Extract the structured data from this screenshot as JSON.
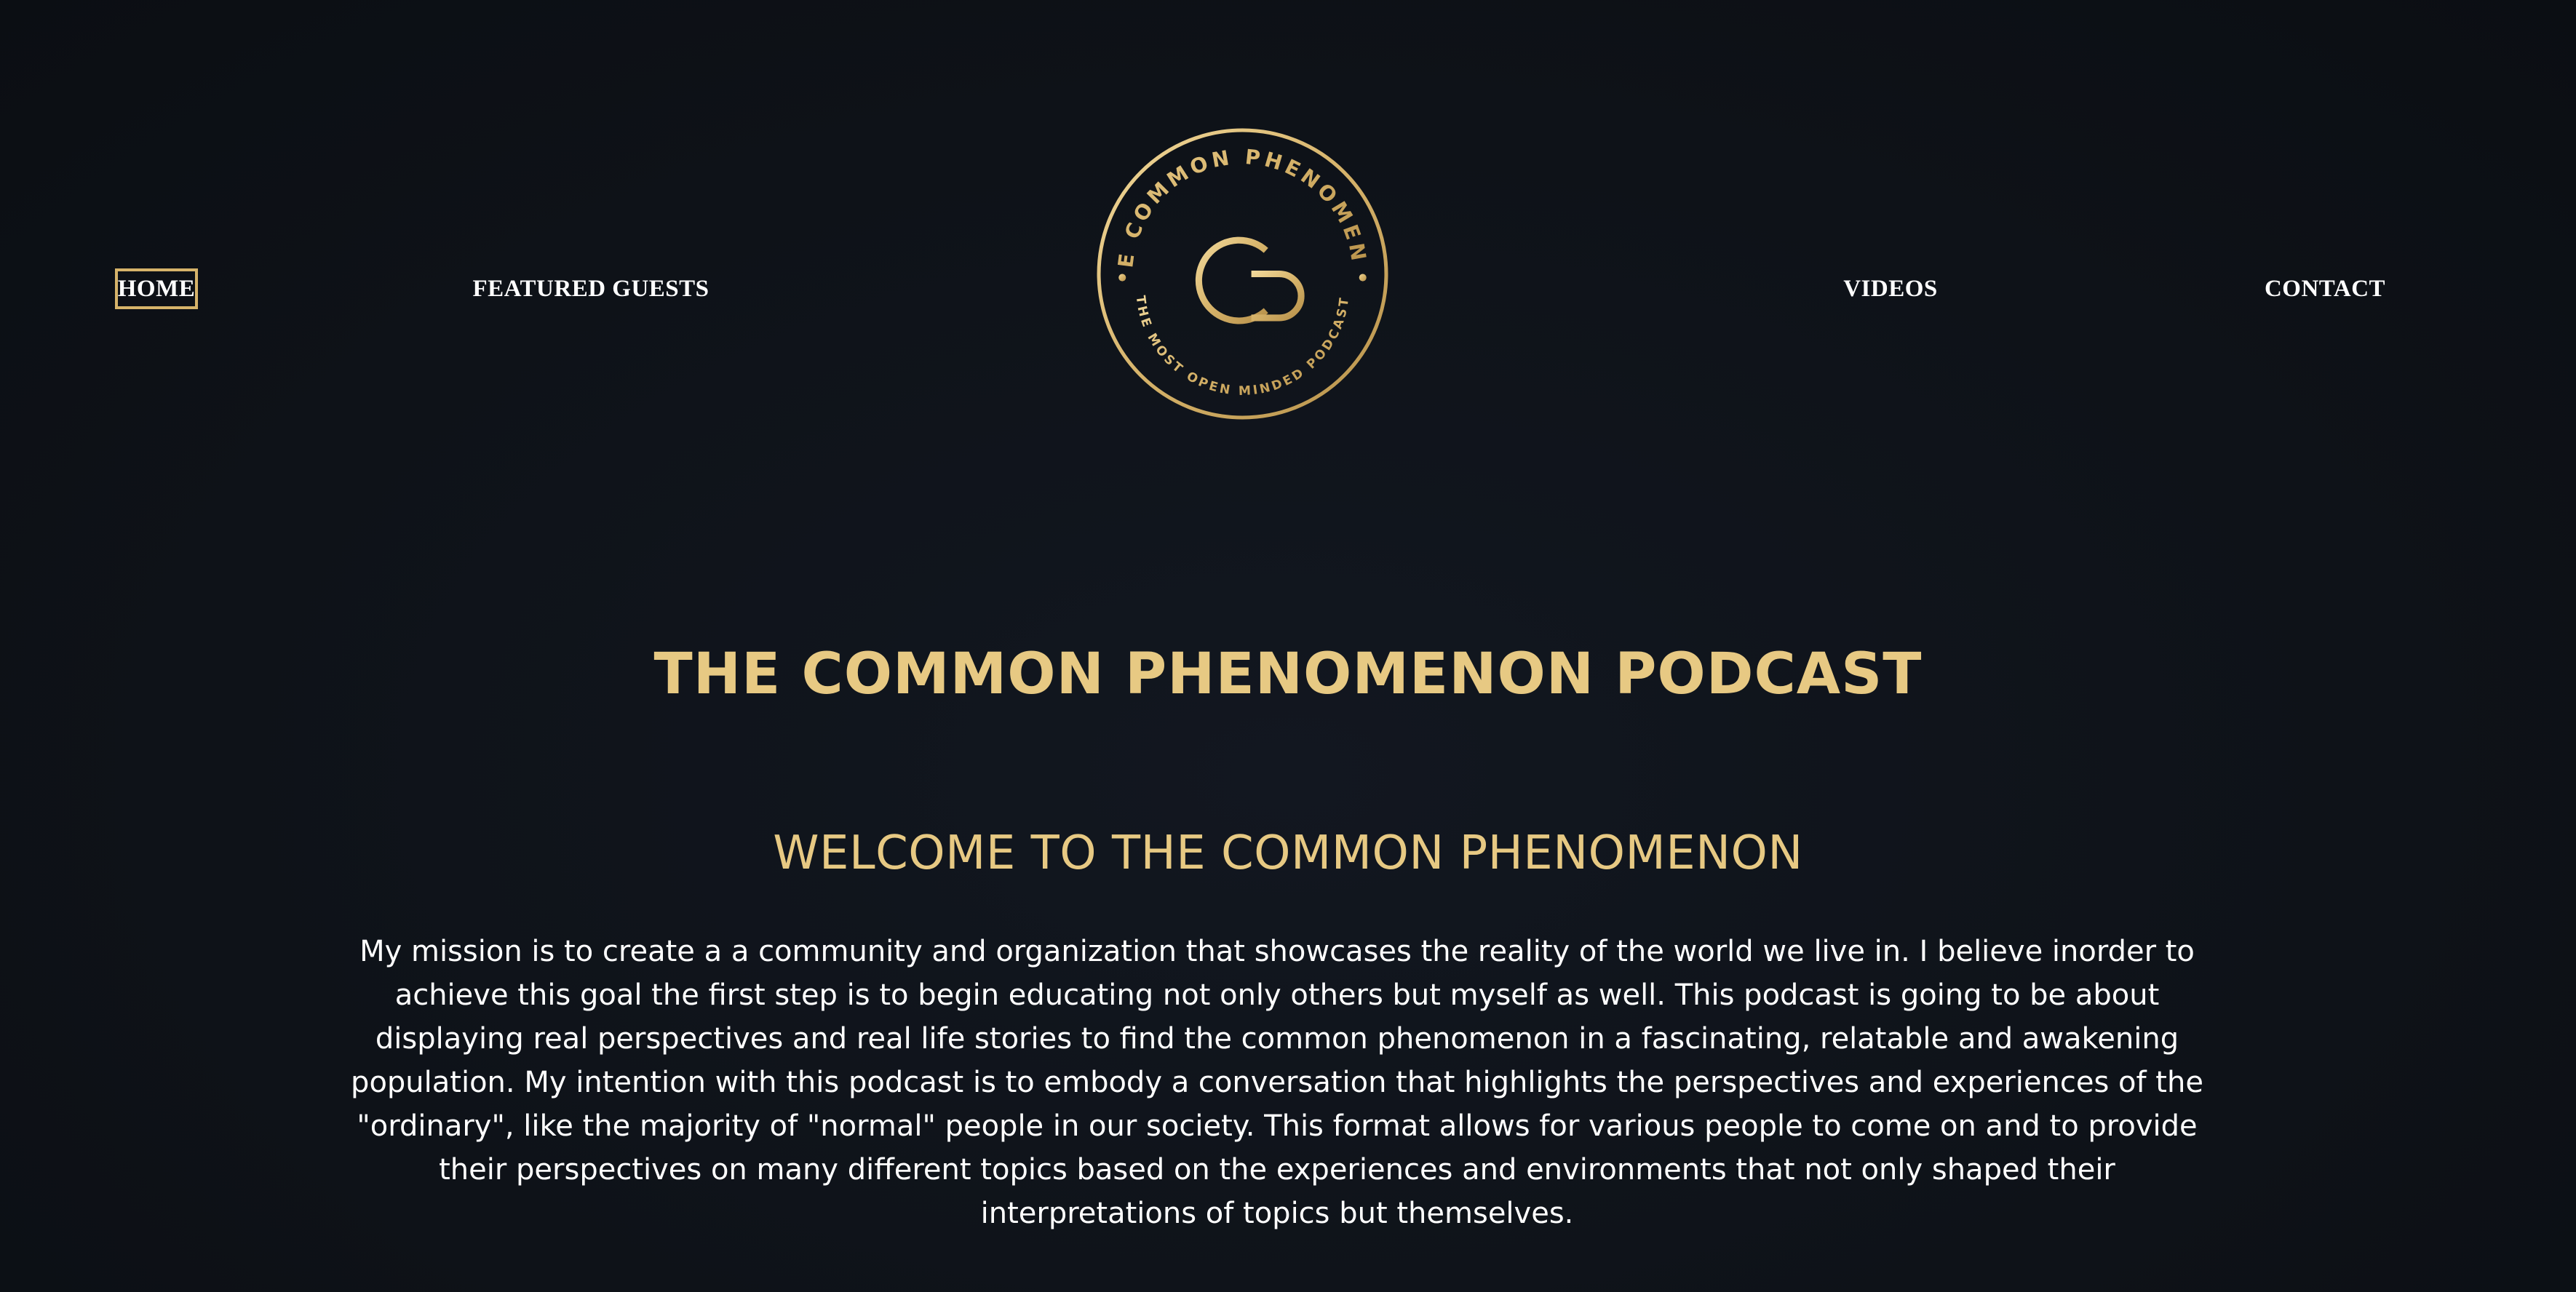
{
  "nav": {
    "home": "HOME",
    "featured_guests": "FEATURED GUESTS",
    "videos": "VIDEOS",
    "contact": "CONTACT"
  },
  "logo": {
    "ring_text_top": "THE COMMON PHENOMENON",
    "ring_text_bottom": "THE MOST OPEN MINDED PODCAST",
    "monogram": "TCP",
    "color": "#d6b36a"
  },
  "hero": {
    "title": "THE COMMON PHENOMENON PODCAST",
    "subtitle": "WELCOME TO THE COMMON PHENOMENON",
    "paragraph": "My mission is to create a a community and organization that showcases the reality of the world we live in. I believe inorder to achieve this goal the first step is to begin educating not only others but myself as well. This podcast is going to be about displaying real perspectives and real life stories to find the common phenomenon in a fascinating, relatable and awakening population. My intention with this podcast is to embody a conversation that highlights the perspectives and experiences of the \"ordinary\", like the majority of \"normal\" people in our society. This format allows for various people to come on and to provide their perspectives on many different topics based on the experiences and environments that not only shaped their interpretations of topics but themselves."
  },
  "colors": {
    "background": "#0f131a",
    "accent_gold": "#e7c983",
    "text": "#ffffff"
  }
}
